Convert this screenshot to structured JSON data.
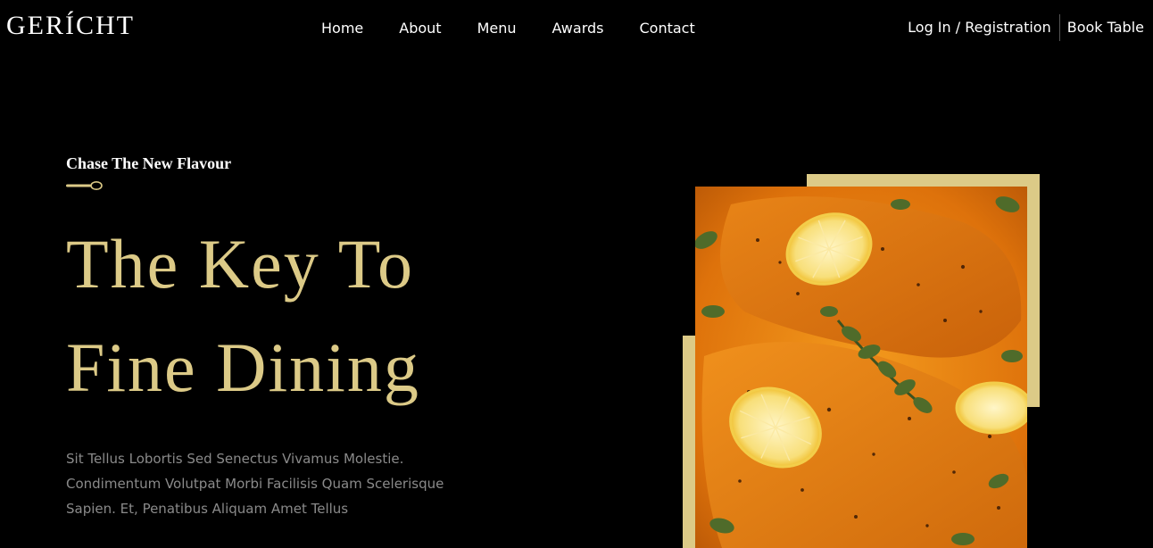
{
  "brand": {
    "logo": "GERÍCHT",
    "accent_color": "#DCCA87"
  },
  "nav": {
    "links": [
      "Home",
      "About",
      "Menu",
      "Awards",
      "Contact"
    ],
    "login_label": "Log In / Registration",
    "book_label": "Book Table"
  },
  "hero": {
    "subtitle": "Chase The New Flavour",
    "subtitle_icon": "spoon-icon",
    "title_lines": [
      "The Key To",
      "Fine Dining"
    ],
    "description_lines": [
      "Sit Tellus Lobortis Sed Senectus Vivamus Molestie.",
      "Condimentum Volutpat Morbi Facilisis Quam Scelerisque",
      "Sapien. Et, Penatibus Aliquam Amet Tellus"
    ],
    "image_subject": "salmon-with-lemon-and-herbs"
  }
}
